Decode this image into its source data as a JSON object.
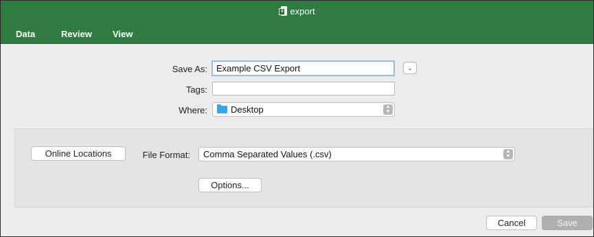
{
  "window": {
    "title": "export"
  },
  "menu": [
    "Data",
    "Review",
    "View"
  ],
  "save_as": {
    "label": "Save As:",
    "value": "Example CSV Export"
  },
  "tags": {
    "label": "Tags:",
    "value": ""
  },
  "where": {
    "label": "Where:",
    "value": "Desktop"
  },
  "online_locations_label": "Online Locations",
  "file_format": {
    "label": "File Format:",
    "value": "Comma Separated Values (.csv)"
  },
  "options_label": "Options...",
  "cancel_label": "Cancel",
  "save_label": "Save",
  "colors": {
    "ribbon": "#2f7b42",
    "dialog_bg": "#ececec",
    "folder": "#3da3e8"
  },
  "icons": {
    "app": "excel-icon",
    "folder": "folder-icon",
    "expand": "chevron-down-icon",
    "stepper": "up-down-chevron-icon"
  }
}
